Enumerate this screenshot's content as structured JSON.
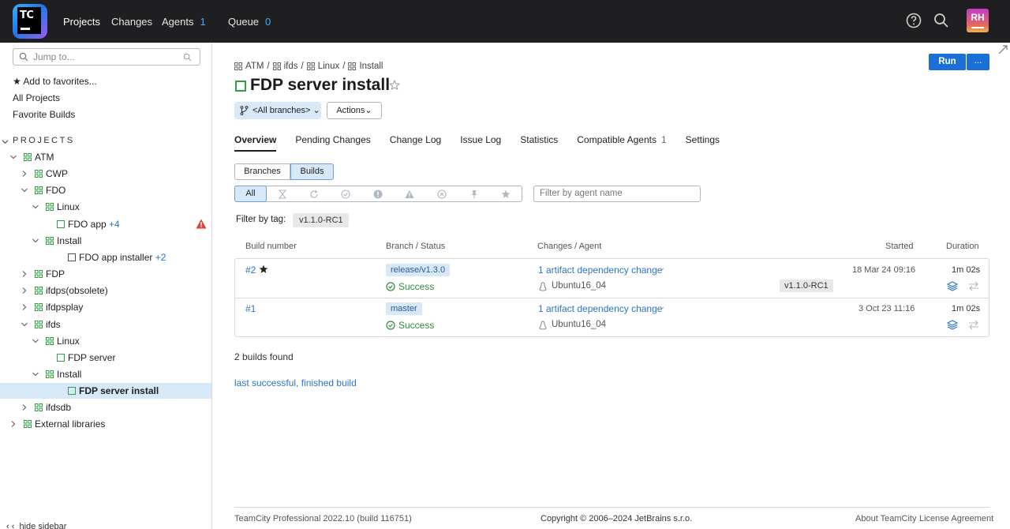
{
  "header": {
    "logo_text": "TC",
    "nav": [
      {
        "label": "Projects",
        "count": ""
      },
      {
        "label": "Changes",
        "count": ""
      },
      {
        "label": "Agents",
        "count": "1"
      },
      {
        "label": "Queue",
        "count": "0"
      }
    ],
    "avatar_initials": "RH"
  },
  "sidebar": {
    "search_placeholder": "Jump to...",
    "add_favorites": "★ Add to favorites...",
    "all_projects": "All Projects",
    "favorite_builds": "Favorite Builds",
    "projects_heading": "PROJECTS",
    "tree": [
      {
        "label": "ATM",
        "extra": "",
        "type": "project",
        "expanded": true
      },
      {
        "label": "CWP",
        "extra": "",
        "type": "project",
        "expanded": false
      },
      {
        "label": "FDO",
        "extra": "",
        "type": "project",
        "expanded": true
      },
      {
        "label": "Linux",
        "extra": "",
        "type": "project",
        "expanded": true
      },
      {
        "label": "FDO app",
        "extra": "+4",
        "type": "build",
        "warning": true
      },
      {
        "label": "Install",
        "extra": "",
        "type": "project",
        "expanded": true
      },
      {
        "label": "FDO app installer",
        "extra": "+2",
        "type": "build-gray"
      },
      {
        "label": "FDP",
        "extra": "",
        "type": "project",
        "expanded": false
      },
      {
        "label": "ifdps(obsolete)",
        "extra": "",
        "type": "project",
        "expanded": false
      },
      {
        "label": "ifdpsplay",
        "extra": "",
        "type": "project",
        "expanded": false
      },
      {
        "label": "ifds",
        "extra": "",
        "type": "project",
        "expanded": true
      },
      {
        "label": "Linux",
        "extra": "",
        "type": "project",
        "expanded": true
      },
      {
        "label": "FDP server",
        "extra": "",
        "type": "build"
      },
      {
        "label": "Install",
        "extra": "",
        "type": "project",
        "expanded": true
      },
      {
        "label": "FDP server install",
        "extra": "",
        "type": "build",
        "selected": true
      },
      {
        "label": "ifdsdb",
        "extra": "",
        "type": "project",
        "expanded": false
      },
      {
        "label": "External libraries",
        "extra": "",
        "type": "project",
        "expanded": false
      }
    ],
    "hide_sidebar": "hide sidebar"
  },
  "breadcrumb": [
    "ATM",
    "ifds",
    "Linux",
    "Install"
  ],
  "page_title": "FDP server install",
  "branch_selector": "<All branches>",
  "actions_label": "Actions",
  "run_label": "Run",
  "more_label": "...",
  "tabs": [
    {
      "label": "Overview",
      "count": ""
    },
    {
      "label": "Pending Changes",
      "count": ""
    },
    {
      "label": "Change Log",
      "count": ""
    },
    {
      "label": "Issue Log",
      "count": ""
    },
    {
      "label": "Statistics",
      "count": ""
    },
    {
      "label": "Compatible Agents",
      "count": "1"
    },
    {
      "label": "Settings",
      "count": ""
    }
  ],
  "view_toggle": {
    "branches": "Branches",
    "builds": "Builds"
  },
  "status_filter": {
    "all": "All",
    "icons": [
      "hourglass-icon",
      "running-icon",
      "check-icon",
      "exclamation-icon",
      "warning-icon",
      "cancel-icon",
      "pin-icon",
      "star-icon"
    ]
  },
  "agent_filter_placeholder": "Filter by agent name",
  "tag_filter": {
    "label": "Filter by tag:",
    "tag": "v1.1.0-RC1"
  },
  "table": {
    "headers": {
      "build_number": "Build number",
      "branch_status": "Branch / Status",
      "changes_agent": "Changes / Agent",
      "started": "Started",
      "duration": "Duration"
    },
    "rows": [
      {
        "number": "#2",
        "starred": true,
        "branch": "release/v1.3.0",
        "status": "Success",
        "changes": "1 artifact dependency change",
        "agent": "Ubuntu16_04",
        "tag": "v1.1.0-RC1",
        "started": "18 Mar 24 09:16",
        "duration": "1m 02s"
      },
      {
        "number": "#1",
        "starred": false,
        "branch": "master",
        "status": "Success",
        "changes": "1 artifact dependency change",
        "agent": "Ubuntu16_04",
        "tag": "",
        "started": "3 Oct 23 11:16",
        "duration": "1m 02s"
      }
    ]
  },
  "builds_found": "2 builds found",
  "last_link": "last successful, finished build",
  "footer": {
    "version": "TeamCity Professional 2022.10 (build 116751)",
    "copyright": "Copyright © 2006–2024 JetBrains s.r.o.",
    "about": "About TeamCity",
    "license": "License Agreement"
  },
  "colors": {
    "header_bg": "#1f1f21",
    "accent": "#1b6fd6",
    "link": "#2a74c9",
    "success": "#2e8b3f",
    "selection": "#d7e8f8"
  }
}
